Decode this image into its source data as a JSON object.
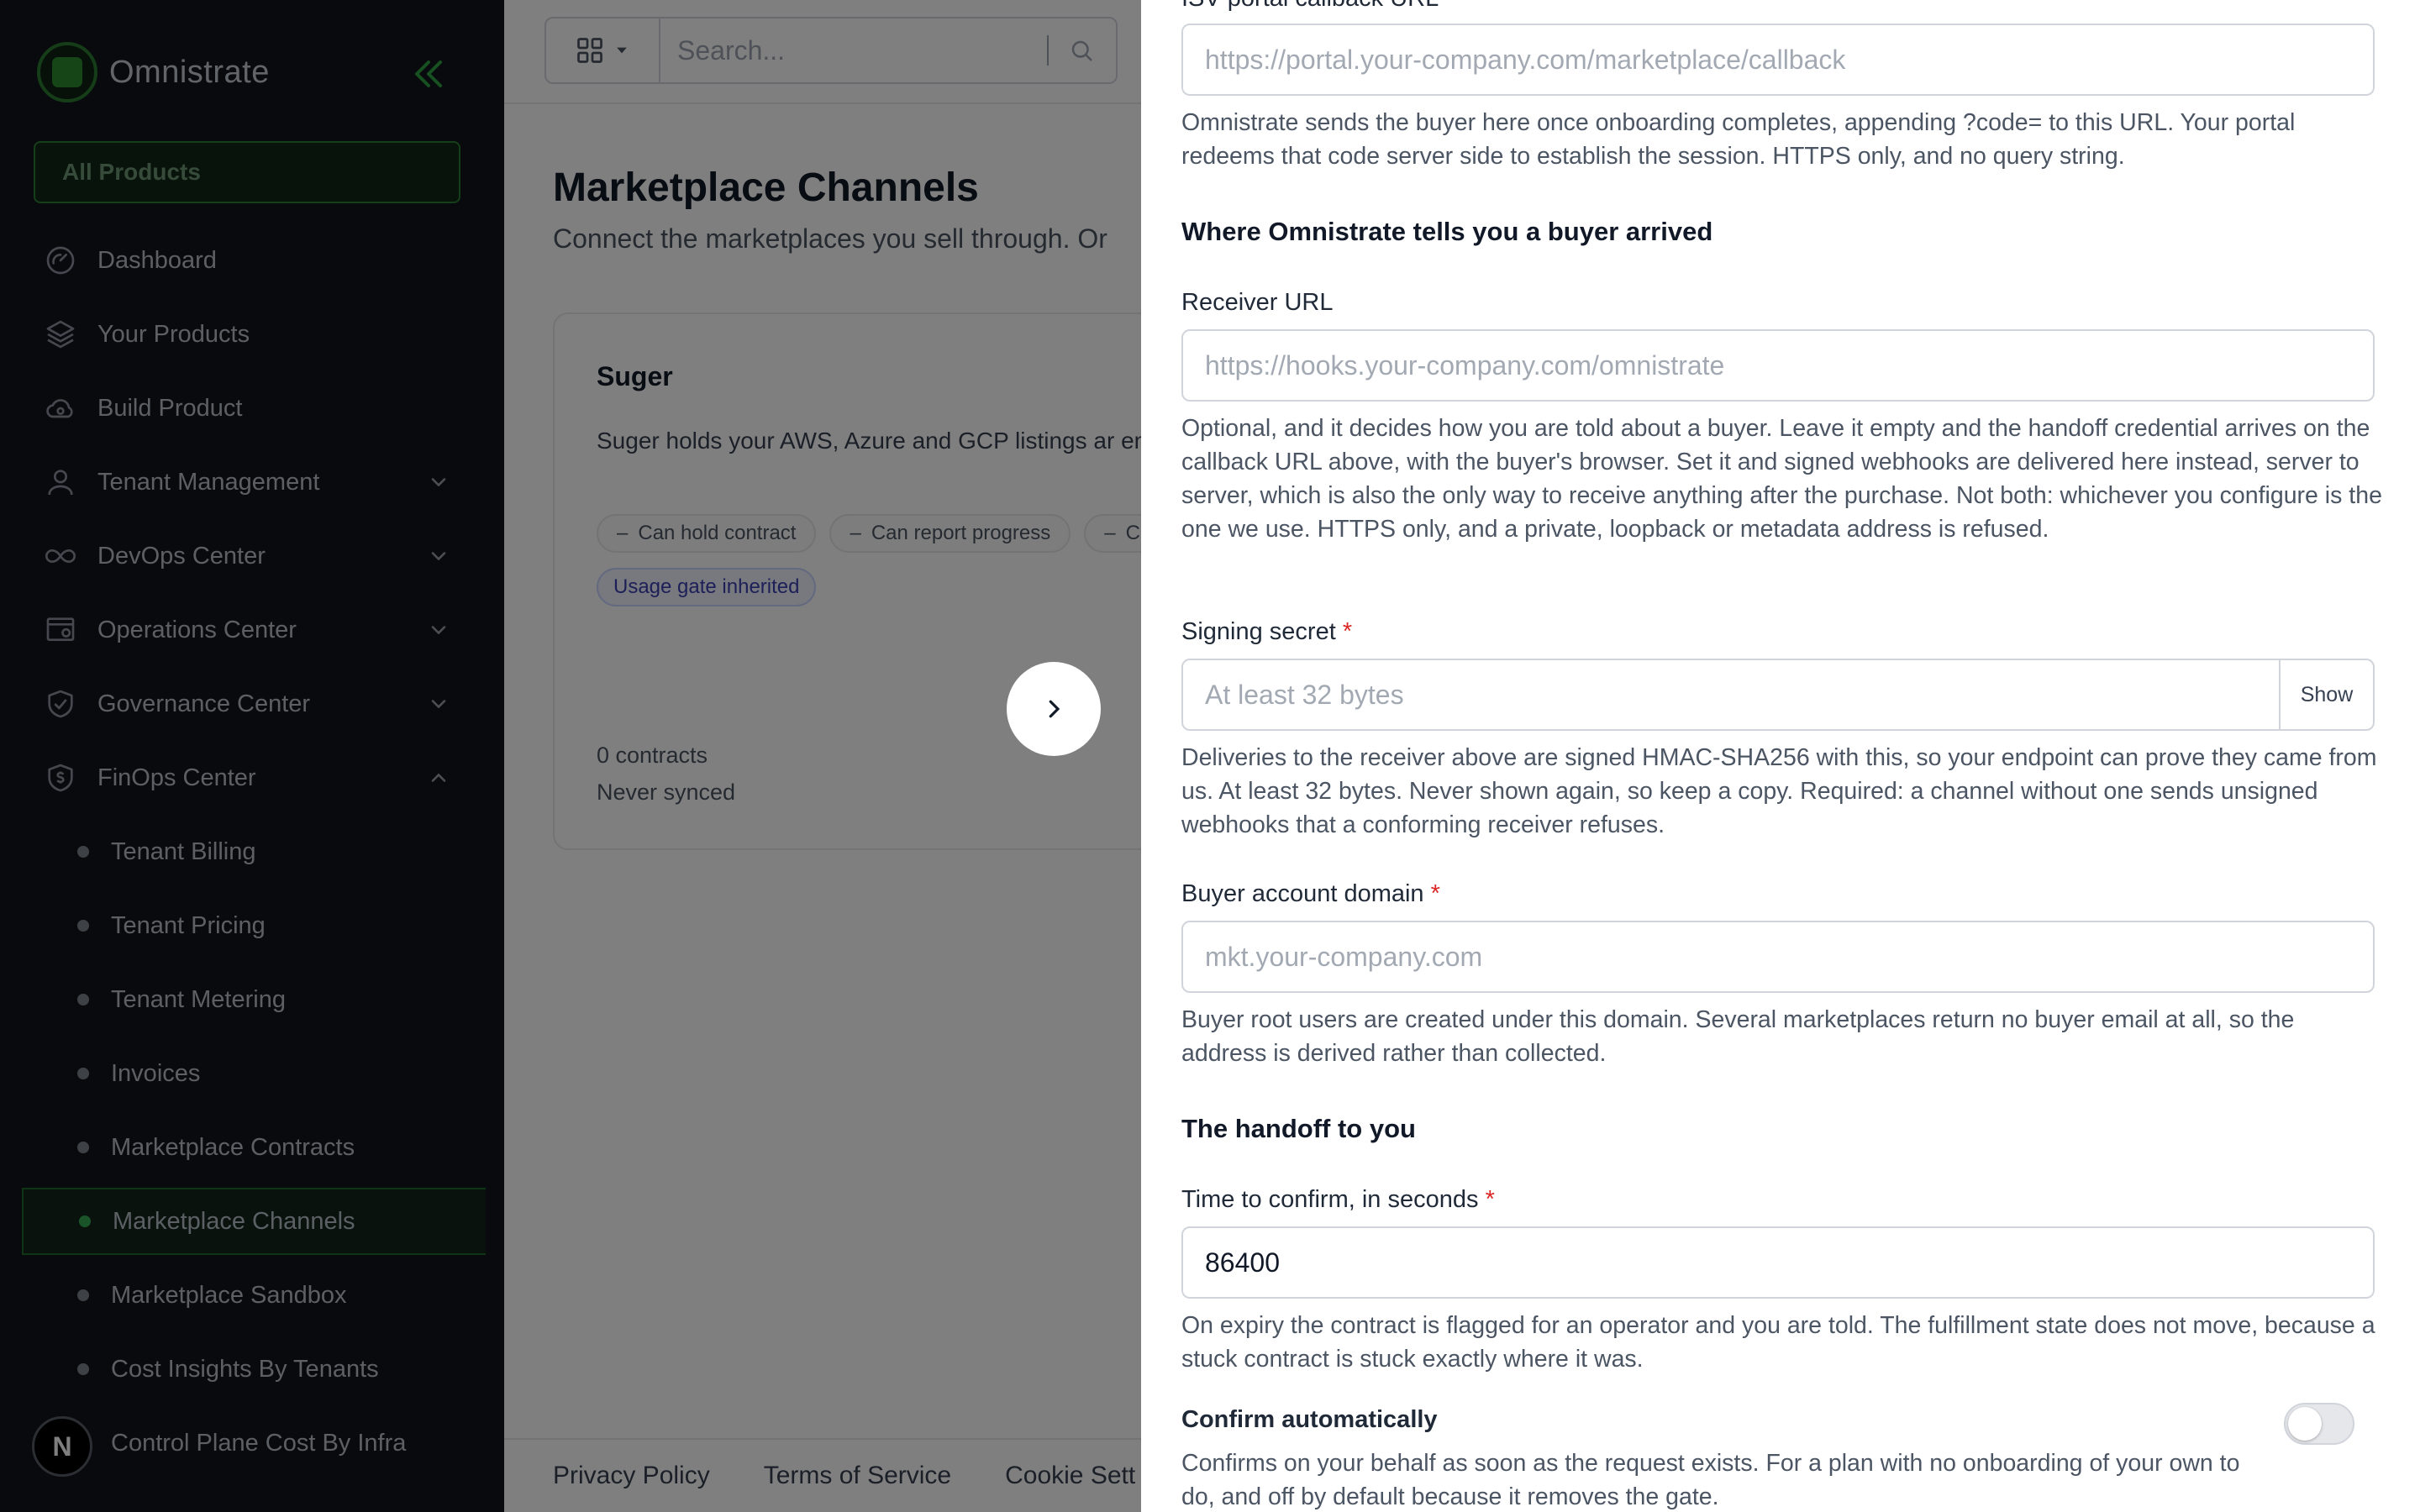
{
  "app": {
    "name": "Omnistrate"
  },
  "sidebar": {
    "all_products": "All Products",
    "items": [
      {
        "label": "Dashboard",
        "icon": "gauge-icon"
      },
      {
        "label": "Your Products",
        "icon": "layers-icon"
      },
      {
        "label": "Build Product",
        "icon": "cloud-build-icon"
      },
      {
        "label": "Tenant Management",
        "icon": "user-icon",
        "expandable": true,
        "expanded": false
      },
      {
        "label": "DevOps Center",
        "icon": "infinity-icon",
        "expandable": true,
        "expanded": false
      },
      {
        "label": "Operations Center",
        "icon": "operations-icon",
        "expandable": true,
        "expanded": false
      },
      {
        "label": "Governance Center",
        "icon": "shield-check-icon",
        "expandable": true,
        "expanded": false
      },
      {
        "label": "FinOps Center",
        "icon": "dollar-shield-icon",
        "expandable": true,
        "expanded": true
      }
    ],
    "finops_subitems": [
      {
        "label": "Tenant Billing"
      },
      {
        "label": "Tenant Pricing"
      },
      {
        "label": "Tenant Metering"
      },
      {
        "label": "Invoices"
      },
      {
        "label": "Marketplace Contracts"
      },
      {
        "label": "Marketplace Channels",
        "active": true
      },
      {
        "label": "Marketplace Sandbox"
      },
      {
        "label": "Cost Insights By Tenants"
      },
      {
        "label": "Control Plane Cost By Infra"
      }
    ],
    "avatar_initial": "N"
  },
  "topbar": {
    "search_placeholder": "Search..."
  },
  "page": {
    "title": "Marketplace Channels",
    "subtitle": "Connect the marketplaces you sell through. Or"
  },
  "card": {
    "title": "Suger",
    "description": "Suger holds your AWS, Azure and GCP listings ar entitlement shape.",
    "chips": [
      "Can hold contract",
      "Can report progress",
      "Ca"
    ],
    "badge": "Usage gate inherited",
    "contracts": "0 contracts",
    "sync_status": "Never synced"
  },
  "footer": {
    "links": [
      "Privacy Policy",
      "Terms of Service",
      "Cookie Sett"
    ]
  },
  "drawer": {
    "callback_label_partial": "ISV portal callback URL",
    "callback": {
      "placeholder": "https://portal.your-company.com/marketplace/callback",
      "help": "Omnistrate sends the buyer here once onboarding completes, appending ?code= to this URL. Your portal redeems that code server side to establish the session. HTTPS only, and no query string."
    },
    "section_buyer": "Where Omnistrate tells you a buyer arrived",
    "receiver": {
      "label": "Receiver URL",
      "placeholder": "https://hooks.your-company.com/omnistrate",
      "help": "Optional, and it decides how you are told about a buyer. Leave it empty and the handoff credential arrives on the callback URL above, with the buyer's browser. Set it and signed webhooks are delivered here instead, server to server, which is also the only way to receive anything after the purchase. Not both: whichever you configure is the one we use. HTTPS only, and a private, loopback or metadata address is refused."
    },
    "secret": {
      "label": "Signing secret",
      "placeholder": "At least 32 bytes",
      "show_label": "Show",
      "help": "Deliveries to the receiver above are signed HMAC-SHA256 with this, so your endpoint can prove they came from us. At least 32 bytes. Never shown again, so keep a copy. Required: a channel without one sends unsigned webhooks that a conforming receiver refuses."
    },
    "domain": {
      "label": "Buyer account domain",
      "placeholder": "mkt.your-company.com",
      "help": "Buyer root users are created under this domain. Several marketplaces return no buyer email at all, so the address is derived rather than collected."
    },
    "section_handoff": "The handoff to you",
    "confirm_time": {
      "label": "Time to confirm, in seconds",
      "value": "86400",
      "help": "On expiry the contract is flagged for an operator and you are told. The fulfillment state does not move, because a stuck contract is stuck exactly where it was."
    },
    "auto_confirm": {
      "label": "Confirm automatically",
      "enabled": false,
      "help": "Confirms on your behalf as soon as the request exists. For a plan with no onboarding of your own to do, and off by default because it removes the gate."
    },
    "required_mark": "*"
  },
  "colors": {
    "sidebar_bg": "#13151c",
    "accent_green": "#2ea043",
    "required_red": "#dc2626"
  }
}
